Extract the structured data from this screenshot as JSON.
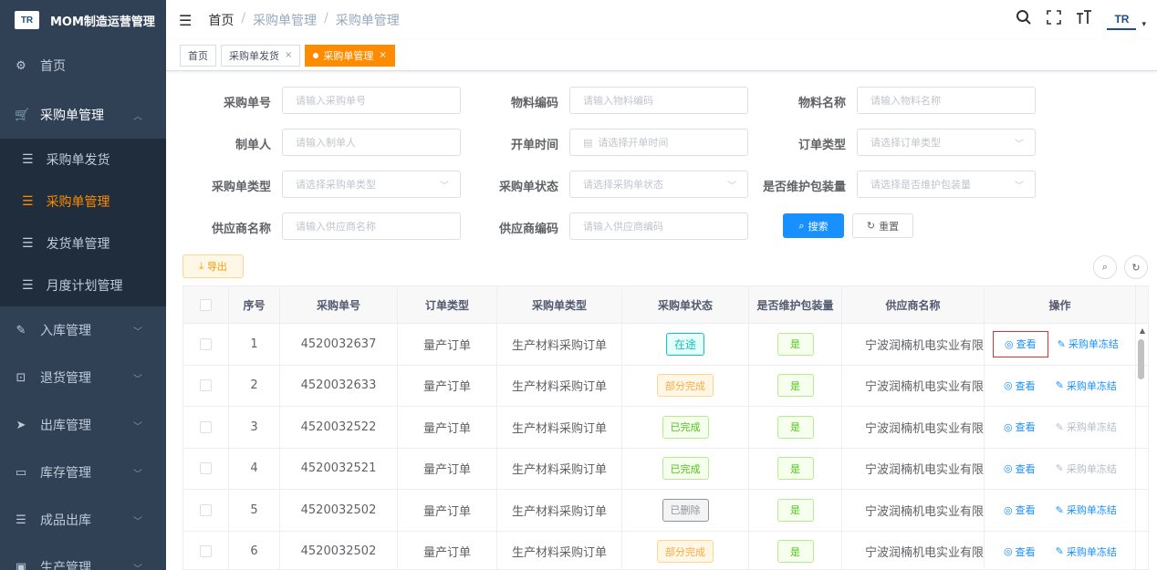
{
  "app": {
    "logo_text": "TR",
    "title": "MOM制造运营管理"
  },
  "sidebar": {
    "items": [
      {
        "label": "首页",
        "icon": "dashboard-icon",
        "glyph": "⚙"
      },
      {
        "label": "采购单管理",
        "icon": "cart-icon",
        "glyph": "🛒",
        "chevron": "︿"
      },
      {
        "label": "入库管理",
        "icon": "edit-icon",
        "glyph": "✎",
        "chevron": "﹀"
      },
      {
        "label": "退货管理",
        "icon": "return-icon",
        "glyph": "⊡",
        "chevron": "﹀"
      },
      {
        "label": "出库管理",
        "icon": "send-icon",
        "glyph": "➤",
        "chevron": "﹀"
      },
      {
        "label": "库存管理",
        "icon": "monitor-icon",
        "glyph": "▭",
        "chevron": "﹀"
      },
      {
        "label": "成品出库",
        "icon": "list-icon",
        "glyph": "☰",
        "chevron": "﹀"
      },
      {
        "label": "生产管理",
        "icon": "production-icon",
        "glyph": "▣",
        "chevron": "﹀"
      }
    ],
    "sub_items": [
      {
        "label": "采购单发货",
        "glyph": "☰"
      },
      {
        "label": "采购单管理",
        "glyph": "☰"
      },
      {
        "label": "发货单管理",
        "glyph": "☰"
      },
      {
        "label": "月度计划管理",
        "glyph": "☰"
      }
    ]
  },
  "navbar": {
    "breadcrumb": [
      "首页",
      "采购单管理",
      "采购单管理"
    ],
    "separator": "/",
    "icons": {
      "hamburger": "☰",
      "search": "🔍",
      "fullscreen": "⛶",
      "font_size": "T"
    },
    "avatar_text": "TR",
    "caret": "▾"
  },
  "tags": [
    {
      "label": "首页"
    },
    {
      "label": "采购单发货",
      "close": "×"
    },
    {
      "label": "采购单管理",
      "close": "×",
      "active": true
    }
  ],
  "filters": {
    "po_no": {
      "label": "采购单号",
      "placeholder": "请输入采购单号"
    },
    "material_code": {
      "label": "物料编码",
      "placeholder": "请输入物料编码"
    },
    "material_name": {
      "label": "物料名称",
      "placeholder": "请输入物料名称"
    },
    "creator": {
      "label": "制单人",
      "placeholder": "请输入制单人"
    },
    "open_time": {
      "label": "开单时间",
      "placeholder": "请选择开单时间",
      "icon": "▤"
    },
    "order_type": {
      "label": "订单类型",
      "placeholder": "请选择订单类型"
    },
    "po_type": {
      "label": "采购单类型",
      "placeholder": "请选择采购单类型"
    },
    "po_status": {
      "label": "采购单状态",
      "placeholder": "请选择采购单状态"
    },
    "maintain_pack": {
      "label": "是否维护包装量",
      "placeholder": "请选择是否维护包装量"
    },
    "supplier_name": {
      "label": "供应商名称",
      "placeholder": "请输入供应商名称"
    },
    "supplier_code": {
      "label": "供应商编码",
      "placeholder": "请输入供应商编码"
    },
    "dropdown_arrow": "﹀"
  },
  "buttons": {
    "search": "搜索",
    "search_icon": "⌕",
    "reset": "重置",
    "reset_icon": "↻",
    "export": "导出",
    "export_icon": "⤓",
    "search_toggle": "⌕",
    "refresh": "↻"
  },
  "table": {
    "headers": [
      "序号",
      "采购单号",
      "订单类型",
      "采购单类型",
      "采购单状态",
      "是否维护包装量",
      "供应商名称",
      "操作"
    ],
    "view_label": "查看",
    "view_icon": "◎",
    "freeze_label": "采购单冻结",
    "freeze_icon": "✎",
    "scroll_up": "▲",
    "rows": [
      {
        "no": "1",
        "po": "4520032637",
        "order_type": "量产订单",
        "po_type": "生产材料采购订单",
        "status": "在途",
        "status_style": "blue",
        "pack": "是",
        "supplier": "宁波润楠机电实业有限",
        "freeze_disabled": false
      },
      {
        "no": "2",
        "po": "4520032633",
        "order_type": "量产订单",
        "po_type": "生产材料采购订单",
        "status": "部分完成",
        "status_style": "orange",
        "pack": "是",
        "supplier": "宁波润楠机电实业有限",
        "freeze_disabled": false
      },
      {
        "no": "3",
        "po": "4520032522",
        "order_type": "量产订单",
        "po_type": "生产材料采购订单",
        "status": "已完成",
        "status_style": "green",
        "pack": "是",
        "supplier": "宁波润楠机电实业有限",
        "freeze_disabled": true
      },
      {
        "no": "4",
        "po": "4520032521",
        "order_type": "量产订单",
        "po_type": "生产材料采购订单",
        "status": "已完成",
        "status_style": "green",
        "pack": "是",
        "supplier": "宁波润楠机电实业有限",
        "freeze_disabled": true
      },
      {
        "no": "5",
        "po": "4520032502",
        "order_type": "量产订单",
        "po_type": "生产材料采购订单",
        "status": "已删除",
        "status_style": "gray",
        "pack": "是",
        "supplier": "宁波润楠机电实业有限",
        "freeze_disabled": false
      },
      {
        "no": "6",
        "po": "4520032502",
        "order_type": "量产订单",
        "po_type": "生产材料采购订单",
        "status": "部分完成",
        "status_style": "orange",
        "pack": "是",
        "supplier": "宁波润楠机电实业有限",
        "freeze_disabled": false
      }
    ]
  }
}
